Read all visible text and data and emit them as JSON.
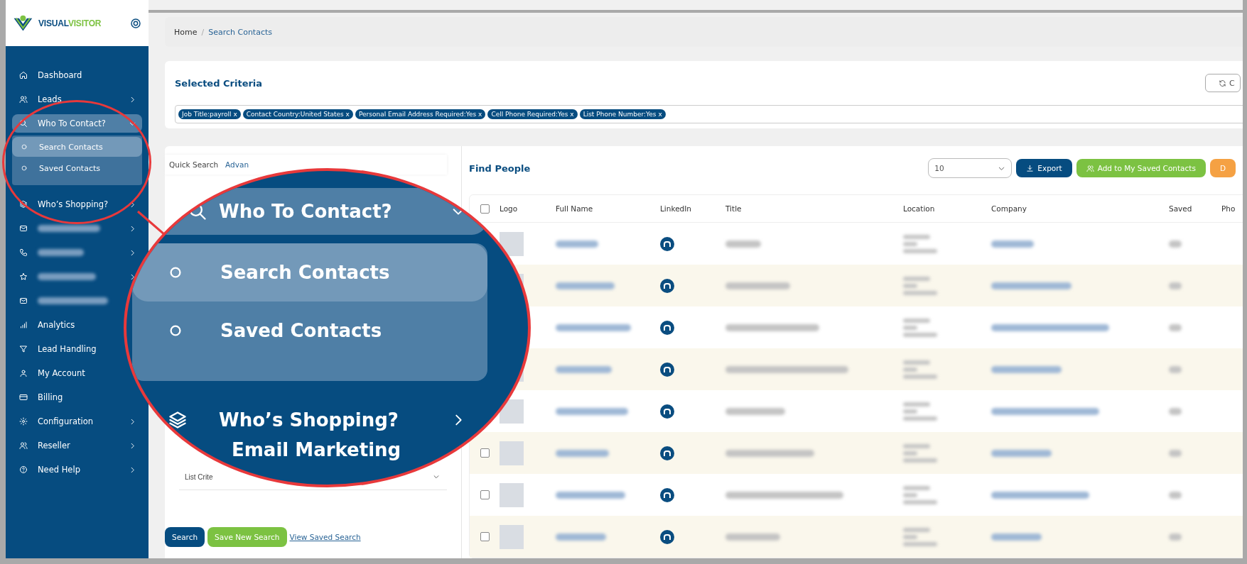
{
  "sidebar": {
    "logo": {
      "part_1": "VISUAL",
      "part_2": "VISITOR"
    },
    "items": [
      {
        "kind": "link",
        "label": "Dashboard"
      },
      {
        "kind": "link",
        "label": "Leads",
        "has_submenu": true,
        "expanded": false
      },
      {
        "kind": "link",
        "label": "Who To Contact?",
        "has_submenu": true,
        "expanded": true,
        "children": [
          {
            "label": "Search Contacts",
            "selected": true
          },
          {
            "label": "Saved Contacts",
            "selected": false
          }
        ]
      },
      {
        "kind": "link",
        "label": "Who’s Shopping?",
        "has_submenu": true,
        "expanded": false
      },
      {
        "kind": "blurred",
        "has_submenu": true
      },
      {
        "kind": "blurred",
        "has_submenu": true
      },
      {
        "kind": "blurred",
        "has_submenu": true
      },
      {
        "kind": "blurred"
      },
      {
        "kind": "link",
        "label": "Analytics"
      },
      {
        "kind": "link",
        "label": "Lead Handling"
      },
      {
        "kind": "link",
        "label": "My Account"
      },
      {
        "kind": "link",
        "label": "Billing"
      },
      {
        "kind": "link",
        "label": "Configuration",
        "has_submenu": true,
        "expanded": false
      },
      {
        "kind": "link",
        "label": "Reseller",
        "has_submenu": true,
        "expanded": false
      },
      {
        "kind": "link",
        "label": "Need Help",
        "has_submenu": true,
        "expanded": false
      }
    ]
  },
  "breadcrumb": {
    "separator": "/",
    "items": [
      {
        "label": "Home",
        "selected": false
      },
      {
        "label": "Search Contacts",
        "selected": true
      }
    ]
  },
  "criteria": {
    "title": "Selected Criteria",
    "button": "C",
    "chips": [
      {
        "label": "Job Title:payroll",
        "remove": "x"
      },
      {
        "label": "Contact Country:United States",
        "remove": "x"
      },
      {
        "label": "Personal Email Address Required:Yes",
        "remove": "x"
      },
      {
        "label": "Cell Phone Required:Yes",
        "remove": "x"
      },
      {
        "label": "List Phone Number:Yes",
        "remove": "x"
      }
    ]
  },
  "search_panel": {
    "tabs": [
      {
        "label": "Quick Search",
        "selected": false
      },
      {
        "label": "Advan",
        "selected": true
      }
    ],
    "list_criteria": "List Crite",
    "buttons": [
      {
        "kind": "primary",
        "label": "Search"
      },
      {
        "kind": "success",
        "label": "Save New Search"
      },
      {
        "kind": "link",
        "label": "View Saved Search"
      }
    ]
  },
  "results": {
    "title": "Find People",
    "page_size": "10",
    "buttons": [
      {
        "kind": "primary",
        "label": "Export"
      },
      {
        "kind": "success",
        "label": "Add to My Saved Contacts"
      },
      {
        "kind": "warning",
        "label": "D"
      }
    ],
    "table": {
      "header_checked": false,
      "columns": [
        "Logo",
        "Full Name",
        "LinkedIn",
        "Title",
        "Location",
        "Company",
        "Saved",
        "Pho"
      ],
      "rows": [
        {
          "checked": false
        },
        {
          "checked": false
        },
        {
          "checked": false
        }
      ]
    }
  },
  "magnifier": {
    "items": [
      {
        "label": "Who To Contact?",
        "has_submenu": true,
        "expanded": true,
        "children": [
          {
            "label": "Search Contacts",
            "selected": true
          },
          {
            "label": "Saved Contacts",
            "selected": false
          }
        ]
      },
      {
        "label": "Who’s Shopping?",
        "has_submenu": true,
        "expanded": false
      },
      {
        "label": "Email Marketing"
      }
    ]
  }
}
